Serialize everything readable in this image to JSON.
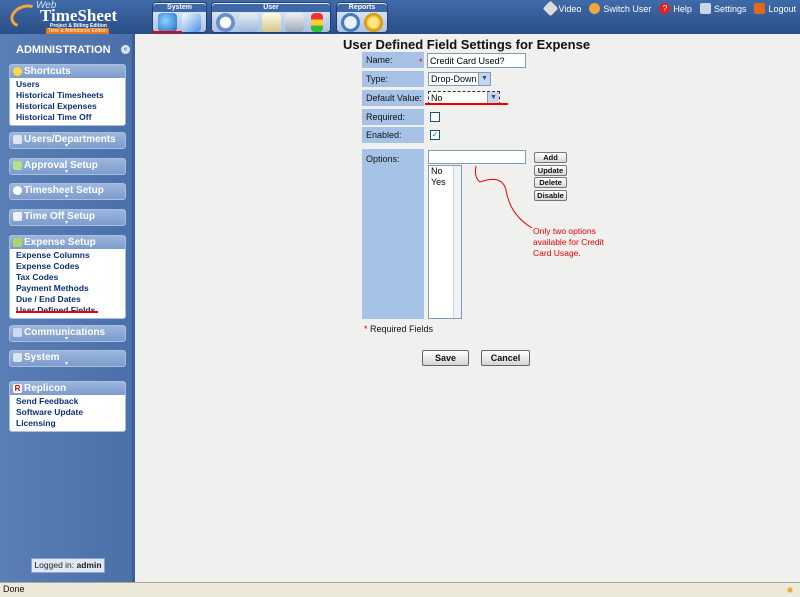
{
  "app": {
    "logo_web": "Web",
    "logo_name": "TimeSheet",
    "logo_edition1": "Project & Billing Edition",
    "logo_edition2": "Time & Attendance Edition"
  },
  "toolbar": {
    "groups": [
      {
        "label": "System",
        "icons": [
          "system-settings-icon",
          "system-check-icon"
        ]
      },
      {
        "label": "User",
        "icons": [
          "clock-icon",
          "timesheet-icon",
          "expense-icon",
          "calculator-icon",
          "traffic-light-icon"
        ]
      },
      {
        "label": "Reports",
        "icons": [
          "report-magnifier-icon",
          "report-gear-icon"
        ]
      }
    ],
    "links": [
      {
        "label": "Video",
        "icon": "video-icon"
      },
      {
        "label": "Switch User",
        "icon": "switch-user-icon"
      },
      {
        "label": "Help",
        "icon": "help-icon"
      },
      {
        "label": "Settings",
        "icon": "settings-icon"
      },
      {
        "label": "Logout",
        "icon": "logout-icon"
      }
    ]
  },
  "sidebar": {
    "title": "ADMINISTRATION",
    "panels": [
      {
        "title": "Shortcuts",
        "items": [
          "Users",
          "Historical Timesheets",
          "Historical Expenses",
          "Historical Time Off"
        ]
      },
      {
        "title": "Users/Departments"
      },
      {
        "title": "Approval Setup"
      },
      {
        "title": "Timesheet Setup"
      },
      {
        "title": "Time Off Setup"
      },
      {
        "title": "Expense Setup",
        "items": [
          "Expense Columns",
          "Expense Codes",
          "Tax Codes",
          "Payment Methods",
          "Due / End Dates",
          "User Defined Fields"
        ]
      },
      {
        "title": "Communications"
      },
      {
        "title": "System"
      },
      {
        "title": "Replicon",
        "items": [
          "Send Feedback",
          "Software Update",
          "Licensing"
        ]
      }
    ],
    "logged_in_label": "Logged in:",
    "logged_in_user": "admin"
  },
  "form": {
    "title": "User Defined Field Settings for Expense",
    "name_label": "Name:",
    "name_value": "Credit Card Used?",
    "type_label": "Type:",
    "type_value": "Drop-Down",
    "default_label": "Default Value:",
    "default_value": "No",
    "required_label": "Required:",
    "required_checked": false,
    "enabled_label": "Enabled:",
    "enabled_checked": true,
    "options_label": "Options:",
    "options_input": "",
    "options": [
      "No",
      "Yes"
    ],
    "buttons": {
      "add": "Add",
      "update": "Update",
      "delete": "Delete",
      "disable": "Disable"
    },
    "required_note": "Required Fields",
    "required_star": "*",
    "save": "Save",
    "cancel": "Cancel"
  },
  "annotation": {
    "text": "Only two options available for Credit Card Usage.",
    "color": "#e00000"
  },
  "statusbar": {
    "text": "Done"
  }
}
